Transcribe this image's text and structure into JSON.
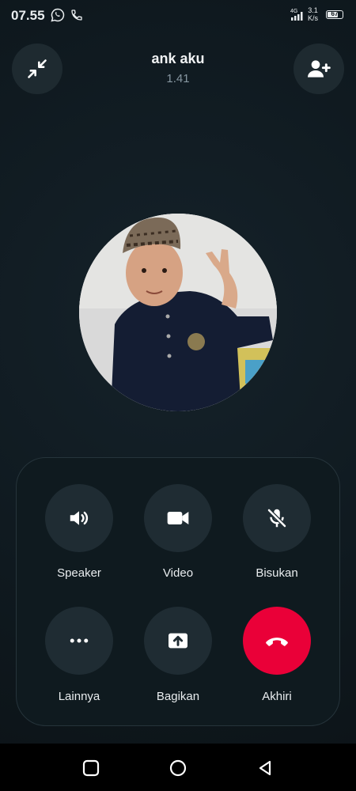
{
  "status_bar": {
    "time": "07.55",
    "network": "4G",
    "speed_value": "3.1",
    "speed_unit": "K/s",
    "battery": "67",
    "battery_level": 0.67,
    "icons": [
      "whatsapp-icon",
      "phone-icon",
      "signal-icon",
      "battery-icon"
    ]
  },
  "header": {
    "contact_name": "ank aku",
    "call_duration": "1.41",
    "icons": [
      "minimize-icon",
      "add-person-icon"
    ]
  },
  "controls": [
    {
      "label": "Speaker",
      "icon": "speaker-icon"
    },
    {
      "label": "Video",
      "icon": "video-icon"
    },
    {
      "label": "Bisukan",
      "icon": "mic-off-icon"
    },
    {
      "label": "Lainnya",
      "icon": "more-icon"
    },
    {
      "label": "Bagikan",
      "icon": "share-screen-icon"
    },
    {
      "label": "Akhiri",
      "icon": "end-call-icon"
    }
  ],
  "colors": {
    "background": "#0d1418",
    "button": "#1f2c33",
    "end_call": "#ea0038",
    "secondary_text": "#8696a0"
  },
  "nav_bar": {
    "icons": [
      "recents-icon",
      "home-icon",
      "back-icon"
    ]
  }
}
